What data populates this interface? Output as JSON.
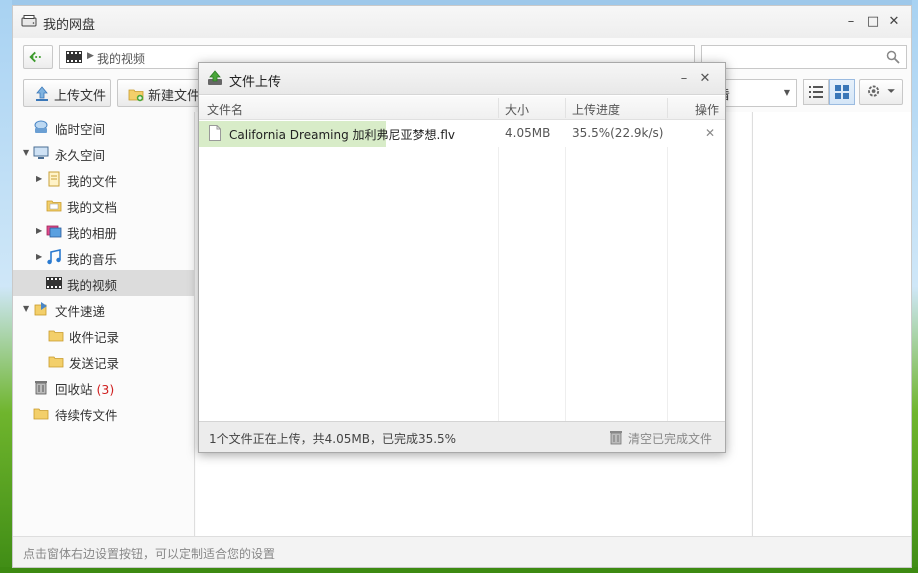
{
  "window": {
    "title": "我的网盘",
    "controls": {
      "minimize": "–",
      "maximize": "□",
      "close": "✕"
    }
  },
  "nav": {
    "path": "我的视频",
    "search_placeholder": ""
  },
  "toolbar": {
    "upload_label": "上传文件",
    "new_file_label": "新建文件",
    "sort_label": "看"
  },
  "sidebar": {
    "items": [
      {
        "label": "临时空间",
        "icon": "cloud-drive-icon"
      },
      {
        "label": "永久空间",
        "icon": "computer-icon"
      },
      {
        "label": "我的文件",
        "icon": "file-doc-icon"
      },
      {
        "label": "我的文档",
        "icon": "folder-doc-icon"
      },
      {
        "label": "我的相册",
        "icon": "photo-album-icon"
      },
      {
        "label": "我的音乐",
        "icon": "music-note-icon"
      },
      {
        "label": "我的视频",
        "icon": "film-icon"
      },
      {
        "label": "文件速递",
        "icon": "express-icon"
      },
      {
        "label": "收件记录",
        "icon": "folder-icon"
      },
      {
        "label": "发送记录",
        "icon": "folder-icon"
      },
      {
        "label": "回收站",
        "count": "(3)",
        "icon": "trash-icon"
      },
      {
        "label": "待续传文件",
        "icon": "folder-icon"
      }
    ]
  },
  "statusbar": {
    "hint": "点击窗体右边设置按钮，可以定制适合您的设置"
  },
  "upload_dialog": {
    "title": "文件上传",
    "columns": {
      "name": "文件名",
      "size": "大小",
      "progress": "上传进度",
      "action": "操作"
    },
    "rows": [
      {
        "name": "California Dreaming 加利弗尼亚梦想.flv",
        "size": "4.05MB",
        "progress": "35.5%(22.9k/s)",
        "progress_fraction": 0.355,
        "delete": "✕"
      }
    ],
    "summary": "1个文件正在上传，共4.05MB，已完成35.5%",
    "clear_label": "清空已完成文件"
  },
  "colors": {
    "progress_fill": "#d8ecc8",
    "selected_item": "#dcdcdc",
    "recycle_count": "#d02020",
    "back_arrow": "#3c9a2c"
  }
}
